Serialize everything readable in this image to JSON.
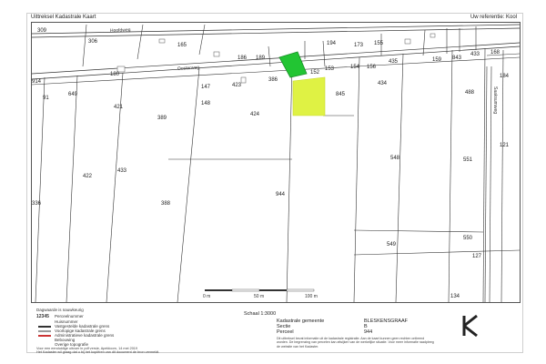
{
  "header": {
    "left": "Uittreksel Kadastrale Kaart",
    "right": "Uw referentie: Kool"
  },
  "parcels": {
    "p306": "306",
    "p309": "309",
    "p165": "165",
    "p186": "186",
    "p194": "194",
    "p173": "173",
    "p155": "155",
    "p435": "435",
    "p159": "159",
    "p843": "843",
    "p433a": "433",
    "p168": "168",
    "p184": "184",
    "p649": "649",
    "p421": "421",
    "p389": "389",
    "p147": "147",
    "p423": "423",
    "p386": "386",
    "p152": "152",
    "p153": "153",
    "p154": "154",
    "p156": "156",
    "p148": "148",
    "p424": "424",
    "p845": "845",
    "p434": "434",
    "p488": "488",
    "p422": "422",
    "p433": "433",
    "p388": "388",
    "p944": "944",
    "p548": "548",
    "p551": "551",
    "p336": "336",
    "p549": "549",
    "p550": "550",
    "p127": "127",
    "p134": "134",
    "p121": "121",
    "p180": "180",
    "p91": "91",
    "p914": "914",
    "p189": "189"
  },
  "roads": {
    "top": "Hoofdweg",
    "middle": "Oosterweg",
    "right_vertical": "Saaksumweg"
  },
  "scale": {
    "label": "Schaal 1:3000",
    "ticks": [
      "0 m",
      "50 m",
      "100 m"
    ]
  },
  "legend": {
    "items": [
      "Dagwaarde is nauwkeurig",
      "Perceelnummer",
      "Huisnummer",
      "Vastgestelde kadastrale grens",
      "Voorlopige kadastrale grens",
      "Administratieve kadastrale grens",
      "Bebouwing",
      "Overige topografie"
    ],
    "number_sample": "12345"
  },
  "footer": {
    "line1": "Voor een eenduidige uitvoer in pdf versie, Apeldoorn, 14 mei 2019",
    "line2": "Het Kadaster wil graag dat u bij het kopiëren van dit document de bron vermeldt."
  },
  "info": {
    "municipality_label": "Kadastrale gemeente",
    "municipality": "BLESKENSGRAAF",
    "section_label": "Sectie",
    "section": "B",
    "parcel_label": "Perceel",
    "parcel": "944"
  },
  "disclaimer": "Dit uittreksel bevat informatie uit de kadastrale registratie. Aan de kaart kunnen geen rechten ontleend worden. De begrenzing van percelen kan afwijken van de werkelijke situatie. Voor meer informatie raadpleeg de website van het Kadaster.",
  "colors": {
    "highlight_green": "#22c533",
    "highlight_yellow": "#dff244",
    "line": "#333333"
  }
}
